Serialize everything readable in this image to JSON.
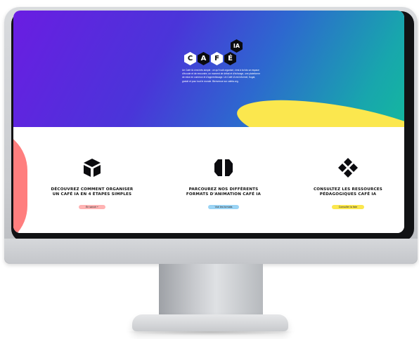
{
  "logo": {
    "letters": [
      "C",
      "A",
      "F",
      "É",
      "IA"
    ]
  },
  "intro_text": "Un Café IA c'est très simple : ce qu'il soit organisé, c'est à la fois un espace d'écoute et de rencontre, un moment de débat et d'échange, une plateforme de mise en commun et d'apprentissage. Un Café IA est informel, frugal, gratuit et pour tout le monde. Bienvenue sur cafeia.org.",
  "features": [
    {
      "title": "DÉCOUVREZ COMMENT ORGANISER UN CAFÉ IA EN 4 ÉTAPES SIMPLES",
      "button": "En savoir +",
      "icon": "cube-icon",
      "button_color": "#ffb3b3"
    },
    {
      "title": "PARCOUREZ NOS DIFFÉRENTS FORMATS D'ANIMATION CAFÉ IA",
      "button": "Voir les formats",
      "icon": "split-hexagon-icon",
      "button_color": "#9ad4f5"
    },
    {
      "title": "CONSULTEZ LES RESSOURCES PÉDAGOGIQUES CAFÉ IA",
      "button": "Consulter la liste",
      "icon": "pinwheel-icon",
      "button_color": "#fbe74e"
    }
  ],
  "colors": {
    "hero_start": "#6a1de2",
    "hero_end": "#14b79f",
    "accent_yellow": "#fbe74e",
    "accent_coral": "#ff7e7e"
  }
}
